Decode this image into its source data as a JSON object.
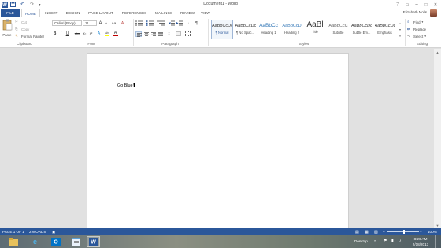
{
  "window": {
    "title": "Document1 - Word"
  },
  "qat": {
    "icons": [
      "word-app-icon",
      "save-icon",
      "undo-icon",
      "redo-icon",
      "customize-qat-icon"
    ]
  },
  "window_controls": {
    "help": "?",
    "ribbon_display": "▭",
    "minimize": "–",
    "maximize": "□",
    "close": "✕"
  },
  "tabs": [
    "FILE",
    "HOME",
    "INSERT",
    "DESIGN",
    "PAGE LAYOUT",
    "REFERENCES",
    "MAILINGS",
    "REVIEW",
    "VIEW"
  ],
  "active_tab": "HOME",
  "user": {
    "name": "Elizabeth Nolls"
  },
  "ribbon": {
    "clipboard": {
      "label": "Clipboard",
      "paste": "Paste",
      "cut": "Cut",
      "copy": "Copy",
      "format_painter": "Format Painter"
    },
    "font": {
      "label": "Font",
      "family": "Calibri (Body)",
      "size": "11",
      "grow": "A",
      "shrink": "A",
      "change_case": "Aa",
      "clear_format": "A",
      "bold": "B",
      "italic": "I",
      "underline": "U",
      "strike": "abc",
      "subscript": "x₂",
      "superscript": "x²",
      "text_effects": "A",
      "highlight": "ab",
      "font_color": "A"
    },
    "paragraph": {
      "label": "Paragraph",
      "show_marks": "¶"
    },
    "styles": {
      "label": "Styles",
      "items": [
        {
          "sample": "AaBbCcDc",
          "name": "¶ Normal"
        },
        {
          "sample": "AaBbCcDc",
          "name": "¶ No Spac..."
        },
        {
          "sample": "AaBbCc",
          "name": "Heading 1"
        },
        {
          "sample": "AaBbCcD",
          "name": "Heading 2"
        },
        {
          "sample": "AaBl",
          "name": "Title"
        },
        {
          "sample": "AaBbCcC",
          "name": "Subtitle"
        },
        {
          "sample": "AaBbCcDc",
          "name": "Subtle Em..."
        },
        {
          "sample": "AaBbCcDc",
          "name": "Emphasis"
        }
      ]
    },
    "editing": {
      "label": "Editing",
      "find": "Find",
      "replace": "Replace",
      "select": "Select"
    }
  },
  "document": {
    "text": "Go Blue!"
  },
  "status": {
    "page": "PAGE 1 OF 1",
    "words": "2 WORDS",
    "zoom": "100%"
  },
  "taskbar": {
    "desktop": "Desktop",
    "time": "8:26 AM",
    "date": "2/18/2013",
    "apps": [
      "file-explorer-icon",
      "internet-explorer-icon",
      "outlook-icon",
      "notepad-icon",
      "word-icon"
    ]
  },
  "colors": {
    "accent": "#2b579a",
    "font_color": "#c00000",
    "highlight": "#ffff00"
  }
}
